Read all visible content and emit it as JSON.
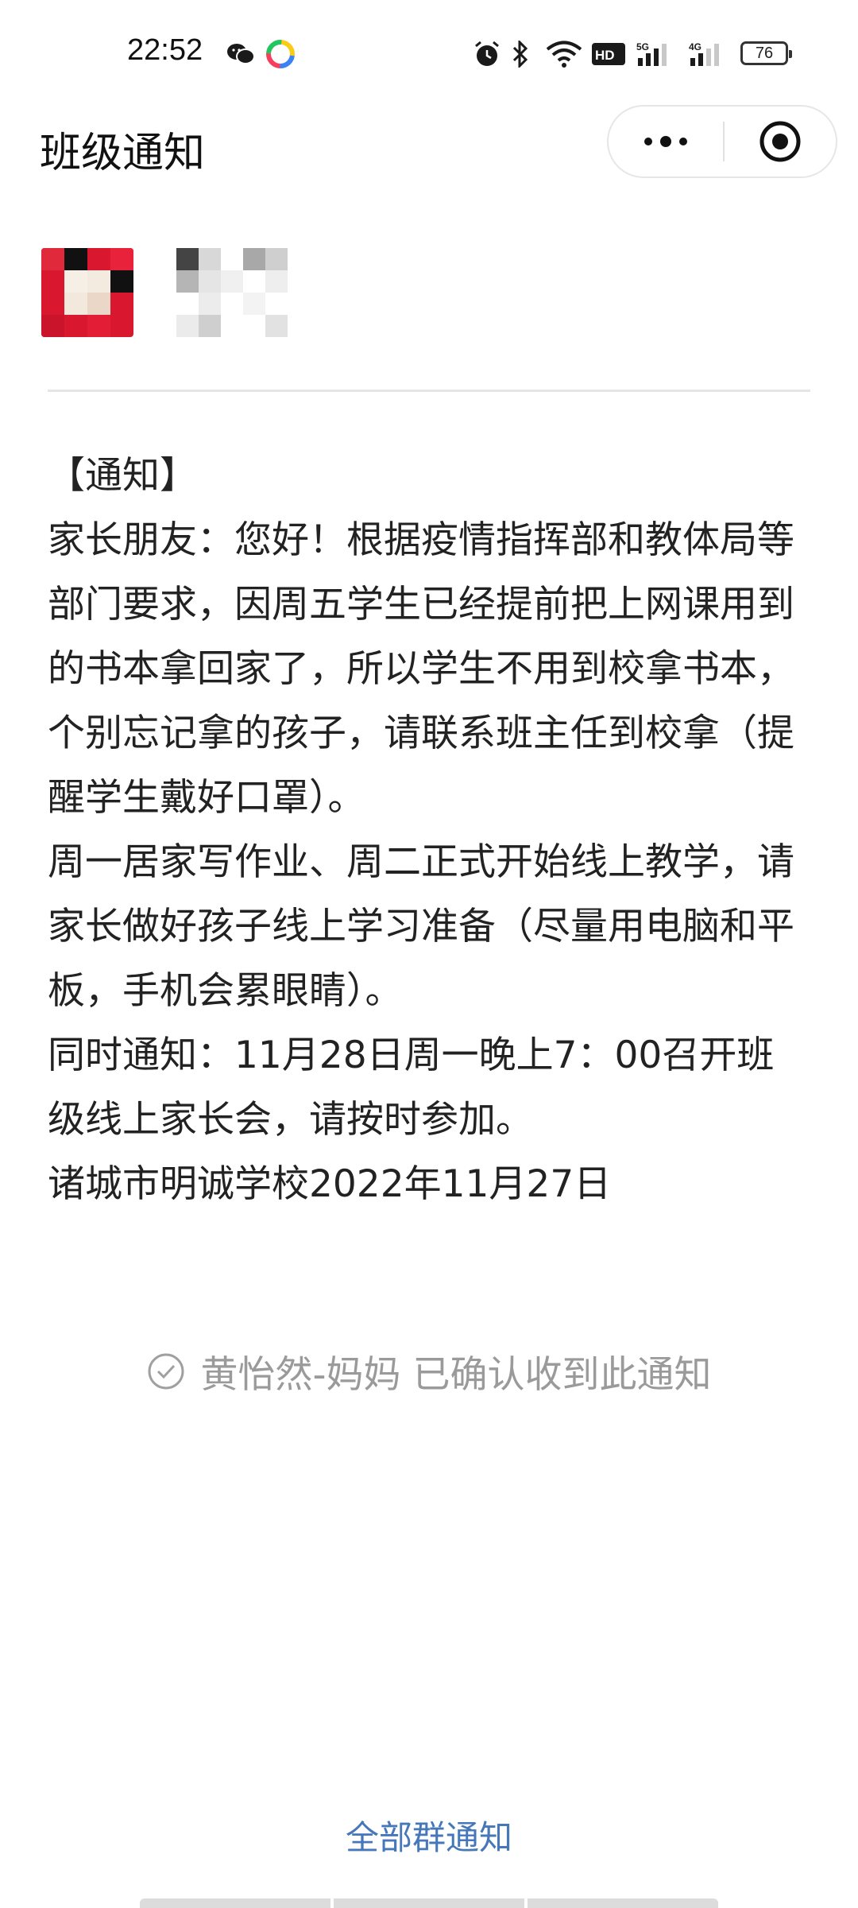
{
  "status_bar": {
    "time": "22:52",
    "battery": "76",
    "icons": [
      "wechat-icon",
      "app-icon",
      "alarm-icon",
      "bluetooth-icon",
      "wifi-icon",
      "hd-icon",
      "signal-5g-icon",
      "signal-4g-icon",
      "battery-icon"
    ]
  },
  "header": {
    "title": "班级通知",
    "more_icon": "more-icon",
    "close_icon": "close-target-icon"
  },
  "notice": {
    "body": "【通知】\n家长朋友：您好！根据疫情指挥部和教体局等部门要求，因周五学生已经提前把上网课用到的书本拿回家了，所以学生不用到校拿书本，个别忘记拿的孩子，请联系班主任到校拿（提醒学生戴好口罩）。\n周一居家写作业、周二正式开始线上教学，请家长做好孩子线上学习准备（尽量用电脑和平板，手机会累眼睛）。\n同时通知：11月28日周一晚上7：00召开班级线上家长会，请按时参加。\n诸城市明诚学校2022年11月27日",
    "confirmation": "黄怡然-妈妈 已确认收到此通知"
  },
  "footer": {
    "all_notices_link": "全部群通知"
  },
  "colors": {
    "link": "#4677b8",
    "muted_text": "#9a9a9a",
    "avatar_red": "#d9182f"
  }
}
